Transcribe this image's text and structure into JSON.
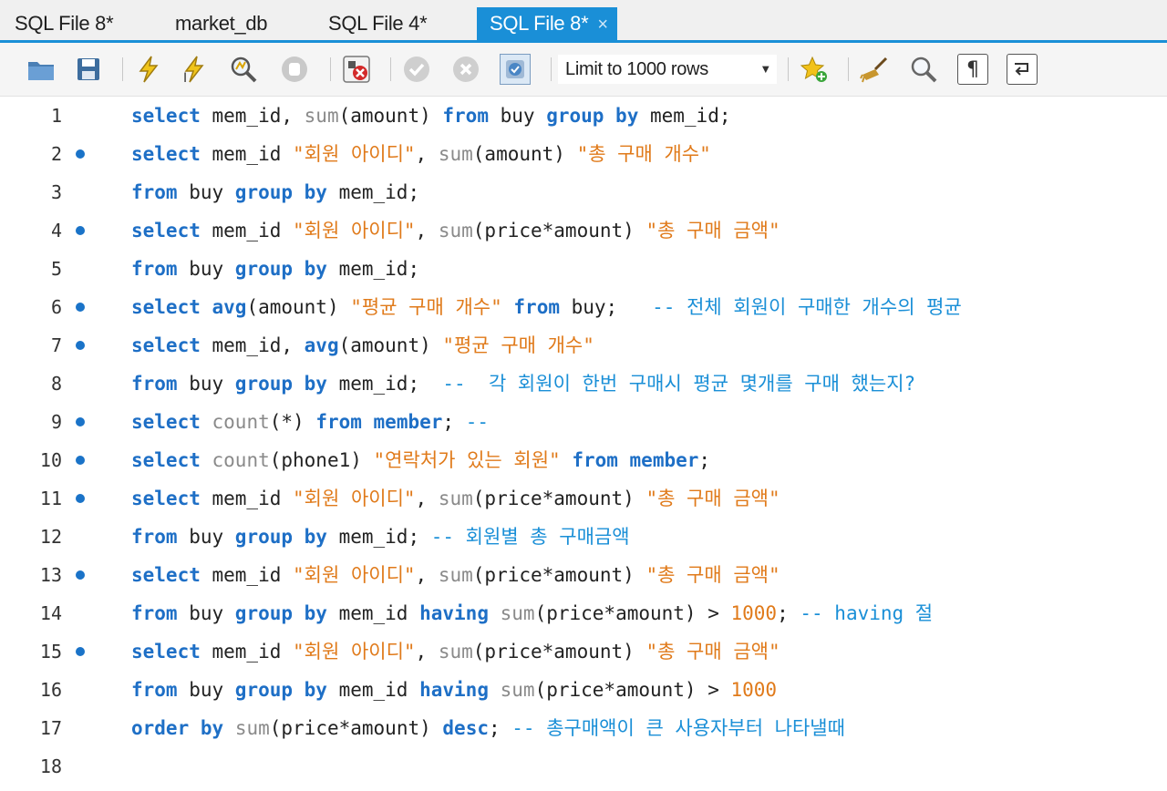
{
  "tabs": [
    {
      "label": "SQL File 8*",
      "active": false
    },
    {
      "label": "market_db",
      "active": false
    },
    {
      "label": "SQL File 4*",
      "active": false
    },
    {
      "label": "SQL File 8*",
      "active": true
    }
  ],
  "tab_close_glyph": "×",
  "toolbar": {
    "limit_label": "Limit to 1000 rows",
    "icons": [
      "open-folder-icon",
      "save-icon",
      "execute-icon",
      "execute-current-icon",
      "explain-icon",
      "stop-icon",
      "toggle-error-icon",
      "commit-icon",
      "rollback-icon",
      "autocommit-icon",
      "add-snippet-icon",
      "beautify-icon",
      "find-icon",
      "invisible-chars-icon",
      "wrap-lines-icon"
    ]
  },
  "colors": {
    "accent": "#1a8fd7",
    "keyword": "#1e6fc6",
    "string": "#e07a1a",
    "comment": "#1a8fd7",
    "function": "#8a8a8a"
  },
  "editor": {
    "lines": [
      {
        "num": "1",
        "dot": false,
        "tokens": [
          [
            "kw",
            "select"
          ],
          [
            "pl",
            " mem_id, "
          ],
          [
            "fn",
            "sum"
          ],
          [
            "pl",
            "(amount) "
          ],
          [
            "kw",
            "from"
          ],
          [
            "pl",
            " buy "
          ],
          [
            "kw",
            "group by"
          ],
          [
            "pl",
            " mem_id;"
          ]
        ]
      },
      {
        "num": "2",
        "dot": true,
        "tokens": [
          [
            "kw",
            "select"
          ],
          [
            "pl",
            " mem_id "
          ],
          [
            "st",
            "\"회원 아이디\""
          ],
          [
            "pl",
            ", "
          ],
          [
            "fn",
            "sum"
          ],
          [
            "pl",
            "(amount) "
          ],
          [
            "st",
            "\"총 구매 개수\""
          ]
        ]
      },
      {
        "num": "3",
        "dot": false,
        "tokens": [
          [
            "kw",
            "from"
          ],
          [
            "pl",
            " buy "
          ],
          [
            "kw",
            "group by"
          ],
          [
            "pl",
            " mem_id;"
          ]
        ]
      },
      {
        "num": "4",
        "dot": true,
        "tokens": [
          [
            "kw",
            "select"
          ],
          [
            "pl",
            " mem_id "
          ],
          [
            "st",
            "\"회원 아이디\""
          ],
          [
            "pl",
            ", "
          ],
          [
            "fn",
            "sum"
          ],
          [
            "pl",
            "(price*amount) "
          ],
          [
            "st",
            "\"총 구매 금액\""
          ]
        ]
      },
      {
        "num": "5",
        "dot": false,
        "tokens": [
          [
            "kw",
            "from"
          ],
          [
            "pl",
            " buy "
          ],
          [
            "kw",
            "group by"
          ],
          [
            "pl",
            " mem_id;"
          ]
        ]
      },
      {
        "num": "6",
        "dot": true,
        "tokens": [
          [
            "kw",
            "select"
          ],
          [
            "pl",
            " "
          ],
          [
            "kw",
            "avg"
          ],
          [
            "pl",
            "(amount) "
          ],
          [
            "st",
            "\"평균 구매 개수\""
          ],
          [
            "pl",
            " "
          ],
          [
            "kw",
            "from"
          ],
          [
            "pl",
            " buy;   "
          ],
          [
            "cm",
            "-- 전체 회원이 구매한 개수의 평균"
          ]
        ]
      },
      {
        "num": "7",
        "dot": true,
        "tokens": [
          [
            "kw",
            "select"
          ],
          [
            "pl",
            " mem_id, "
          ],
          [
            "kw",
            "avg"
          ],
          [
            "pl",
            "(amount) "
          ],
          [
            "st",
            "\"평균 구매 개수\""
          ]
        ]
      },
      {
        "num": "8",
        "dot": false,
        "tokens": [
          [
            "kw",
            "from"
          ],
          [
            "pl",
            " buy "
          ],
          [
            "kw",
            "group by"
          ],
          [
            "pl",
            " mem_id;  "
          ],
          [
            "cm",
            "--  각 회원이 한번 구매시 평균 몇개를 구매 했는지?"
          ]
        ]
      },
      {
        "num": "9",
        "dot": true,
        "tokens": [
          [
            "kw",
            "select"
          ],
          [
            "pl",
            " "
          ],
          [
            "fn",
            "count"
          ],
          [
            "pl",
            "(*) "
          ],
          [
            "kw",
            "from member"
          ],
          [
            "pl",
            "; "
          ],
          [
            "cm",
            "--"
          ]
        ]
      },
      {
        "num": "10",
        "dot": true,
        "tokens": [
          [
            "kw",
            "select"
          ],
          [
            "pl",
            " "
          ],
          [
            "fn",
            "count"
          ],
          [
            "pl",
            "(phone1) "
          ],
          [
            "st",
            "\"연락처가 있는 회원\""
          ],
          [
            "pl",
            " "
          ],
          [
            "kw",
            "from member"
          ],
          [
            "pl",
            ";"
          ]
        ]
      },
      {
        "num": "11",
        "dot": true,
        "tokens": [
          [
            "kw",
            "select"
          ],
          [
            "pl",
            " mem_id "
          ],
          [
            "st",
            "\"회원 아이디\""
          ],
          [
            "pl",
            ", "
          ],
          [
            "fn",
            "sum"
          ],
          [
            "pl",
            "(price*amount) "
          ],
          [
            "st",
            "\"총 구매 금액\""
          ]
        ]
      },
      {
        "num": "12",
        "dot": false,
        "tokens": [
          [
            "kw",
            "from"
          ],
          [
            "pl",
            " buy "
          ],
          [
            "kw",
            "group by"
          ],
          [
            "pl",
            " mem_id; "
          ],
          [
            "cm",
            "-- 회원별 총 구매금액"
          ]
        ]
      },
      {
        "num": "13",
        "dot": true,
        "tokens": [
          [
            "kw",
            "select"
          ],
          [
            "pl",
            " mem_id "
          ],
          [
            "st",
            "\"회원 아이디\""
          ],
          [
            "pl",
            ", "
          ],
          [
            "fn",
            "sum"
          ],
          [
            "pl",
            "(price*amount) "
          ],
          [
            "st",
            "\"총 구매 금액\""
          ]
        ]
      },
      {
        "num": "14",
        "dot": false,
        "tokens": [
          [
            "kw",
            "from"
          ],
          [
            "pl",
            " buy "
          ],
          [
            "kw",
            "group by"
          ],
          [
            "pl",
            " mem_id "
          ],
          [
            "kw",
            "having"
          ],
          [
            "pl",
            " "
          ],
          [
            "fn",
            "sum"
          ],
          [
            "pl",
            "(price*amount) > "
          ],
          [
            "nu",
            "1000"
          ],
          [
            "pl",
            "; "
          ],
          [
            "cm",
            "-- having 절"
          ]
        ]
      },
      {
        "num": "15",
        "dot": true,
        "tokens": [
          [
            "kw",
            "select"
          ],
          [
            "pl",
            " mem_id "
          ],
          [
            "st",
            "\"회원 아이디\""
          ],
          [
            "pl",
            ", "
          ],
          [
            "fn",
            "sum"
          ],
          [
            "pl",
            "(price*amount) "
          ],
          [
            "st",
            "\"총 구매 금액\""
          ]
        ]
      },
      {
        "num": "16",
        "dot": false,
        "tokens": [
          [
            "kw",
            "from"
          ],
          [
            "pl",
            " buy "
          ],
          [
            "kw",
            "group by"
          ],
          [
            "pl",
            " mem_id "
          ],
          [
            "kw",
            "having"
          ],
          [
            "pl",
            " "
          ],
          [
            "fn",
            "sum"
          ],
          [
            "pl",
            "(price*amount) > "
          ],
          [
            "nu",
            "1000"
          ]
        ]
      },
      {
        "num": "17",
        "dot": false,
        "tokens": [
          [
            "kw",
            "order by"
          ],
          [
            "pl",
            " "
          ],
          [
            "fn",
            "sum"
          ],
          [
            "pl",
            "(price*amount) "
          ],
          [
            "kw",
            "desc"
          ],
          [
            "pl",
            "; "
          ],
          [
            "cm",
            "-- 총구매액이 큰 사용자부터 나타낼때"
          ]
        ]
      },
      {
        "num": "18",
        "dot": false,
        "tokens": []
      }
    ]
  }
}
